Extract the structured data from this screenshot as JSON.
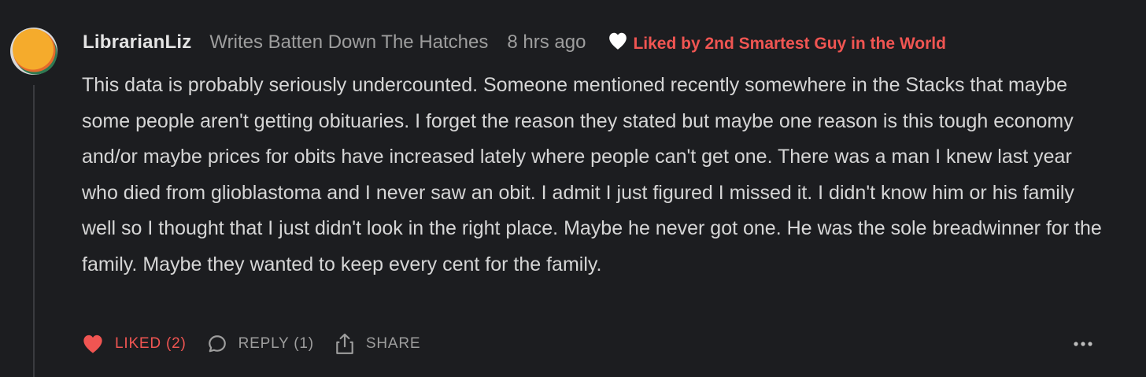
{
  "comment": {
    "author": "LibrarianLiz",
    "publication": "Writes Batten Down The Hatches",
    "timestamp": "8 hrs ago",
    "liked_by": "Liked by 2nd Smartest Guy in the World",
    "body": "This data is probably seriously undercounted. Someone mentioned recently somewhere in the Stacks that maybe some people aren't getting obituaries. I forget the reason they stated but maybe one reason is this tough economy and/or maybe prices for obits have increased lately where people can't get one. There was a man I knew last year who died from glioblastoma and I never saw an obit. I admit I just figured I missed it. I didn't know him or his family well so I thought that I just didn't look in the right place. Maybe he never got one. He was the sole breadwinner for the family. Maybe they wanted to keep every cent for the family."
  },
  "actions": {
    "like_label": "LIKED (2)",
    "reply_label": "REPLY (1)",
    "share_label": "SHARE"
  },
  "icons": {
    "avatar": "avatar",
    "liked_heart": "heart-outline-icon",
    "like": "heart-filled-icon",
    "reply": "speech-bubble-icon",
    "share": "share-icon",
    "more": "ellipsis-icon"
  },
  "colors": {
    "background": "#1c1d20",
    "accent_red": "#f05552",
    "avatar_orange": "#f5ab2c",
    "avatar_green": "#2f7a52",
    "avatar_teal": "#3c8f86"
  }
}
